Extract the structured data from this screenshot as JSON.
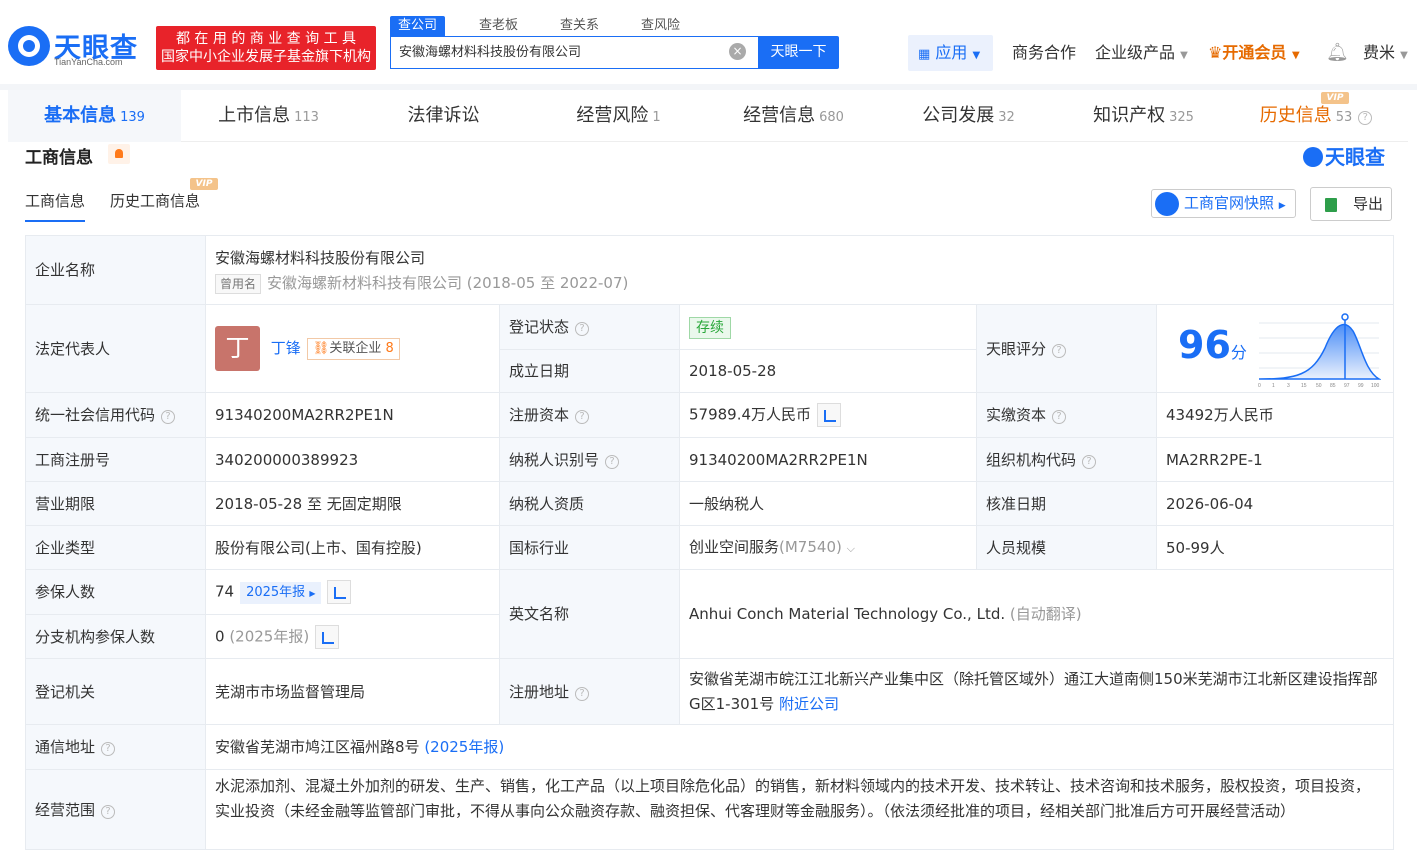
{
  "header": {
    "logo_name": "天眼查",
    "logo_domain": "TianYanCha.com",
    "slogan1": "都 在 用 的 商 业 查 询 工 具",
    "slogan2": "国家中小企业发展子基金旗下机构",
    "search_tabs": [
      "查公司",
      "查老板",
      "查关系",
      "查风险"
    ],
    "search_value": "安徽海螺材料科技股份有限公司",
    "search_button": "天眼一下",
    "app": "应用",
    "nav": [
      "商务合作",
      "企业级产品",
      "开通会员",
      "费米"
    ]
  },
  "tabs": [
    {
      "label": "基本信息",
      "count": "139"
    },
    {
      "label": "上市信息",
      "count": "113"
    },
    {
      "label": "法律诉讼",
      "count": ""
    },
    {
      "label": "经营风险",
      "count": "1"
    },
    {
      "label": "经营信息",
      "count": "680"
    },
    {
      "label": "公司发展",
      "count": "32"
    },
    {
      "label": "知识产权",
      "count": "325"
    },
    {
      "label": "历史信息",
      "count": "53"
    }
  ],
  "vip_label": "VIP",
  "section": {
    "title": "工商信息",
    "watermark": "天眼查",
    "subtab1": "工商信息",
    "subtab2": "历史工商信息",
    "quick_button": "工商官网快照",
    "export_button": "导出"
  },
  "info": {
    "name_k": "企业名称",
    "name_v": "安徽海螺材料科技股份有限公司",
    "used_tag": "曾用名",
    "used_v": "安徽海螺新材料科技有限公司 (2018-05 至 2022-07)",
    "legal_k": "法定代表人",
    "legal_avatar": "丁",
    "legal_v": "丁锋",
    "legal_rel": "关联企业",
    "legal_rel_n": "8",
    "status_k": "登记状态",
    "status_v": "存续",
    "found_k": "成立日期",
    "found_v": "2018-05-28",
    "score_k": "天眼评分",
    "score_v": "96",
    "score_unit": "分",
    "credit_k": "统一社会信用代码",
    "credit_v": "91340200MA2RR2PE1N",
    "capital_k": "注册资本",
    "capital_v": "57989.4万人民币",
    "paid_k": "实缴资本",
    "paid_v": "43492万人民币",
    "regno_k": "工商注册号",
    "regno_v": "340200000389923",
    "tax_k": "纳税人识别号",
    "tax_v": "91340200MA2RR2PE1N",
    "org_k": "组织机构代码",
    "org_v": "MA2RR2PE-1",
    "term_k": "营业期限",
    "term_v": "2018-05-28 至 无固定期限",
    "taxq_k": "纳税人资质",
    "taxq_v": "一般纳税人",
    "approve_k": "核准日期",
    "approve_v": "2026-06-04",
    "type_k": "企业类型",
    "type_v": "股份有限公司(上市、国有控股)",
    "industry_k": "国标行业",
    "industry_v": "创业空间服务",
    "industry_code": "(M7540)",
    "staff_k": "人员规模",
    "staff_v": "50-99人",
    "ins_k": "参保人数",
    "ins_v": "74",
    "ins_rep": "2025年报",
    "branch_k": "分支机构参保人数",
    "branch_v": "0",
    "branch_rep": "(2025年报)",
    "en_k": "英文名称",
    "en_v": "Anhui Conch Material Technology Co., Ltd.",
    "en_note": "(自动翻译)",
    "auth_k": "登记机关",
    "auth_v": "芜湖市市场监督管理局",
    "addr_k": "注册地址",
    "addr_v": "安徽省芜湖市皖江江北新兴产业集中区（除托管区域外）通江大道南侧150米芜湖市江北新区建设指挥部G区1-301号",
    "addr_link": "附近公司",
    "mail_k": "通信地址",
    "mail_v": "安徽省芜湖市鸠江区福州路8号",
    "mail_rep": "(2025年报)",
    "scope_k": "经营范围",
    "scope_v": "水泥添加剂、混凝土外加剂的研发、生产、销售，化工产品（以上项目除危化品）的销售，新材料领域内的技术开发、技术转让、技术咨询和技术服务，股权投资，项目投资，实业投资（未经金融等监管部门审批，不得从事向公众融资存款、融资担保、代客理财等金融服务）。（依法须经批准的项目，经相关部门批准后方可开展经营活动）"
  },
  "score_axis": [
    "0",
    "1",
    "3",
    "15",
    "50",
    "85",
    "97",
    "99",
    "100"
  ],
  "colors": {
    "brand": "#1a6ef5",
    "vip": "#e66a00",
    "slogan_bg": "#e8232a"
  }
}
